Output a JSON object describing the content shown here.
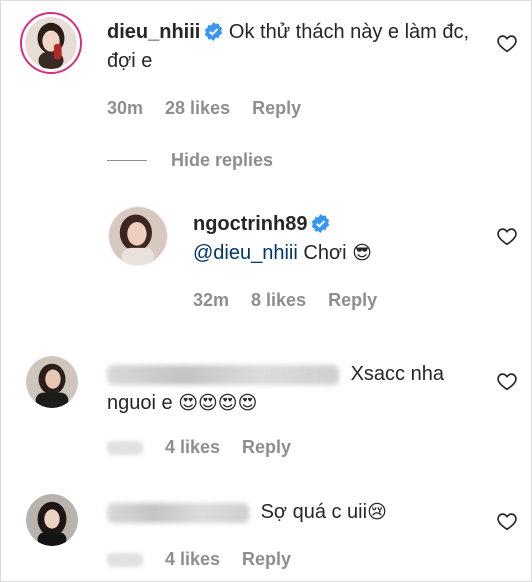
{
  "comments": [
    {
      "username": "dieu_nhiii",
      "verified": true,
      "text": "Ok thử thách này e làm đc, đợi e",
      "time": "30m",
      "likes": "28 likes",
      "reply": "Reply"
    },
    {
      "username": "ngoctrinh89",
      "verified": true,
      "mention": "@dieu_nhiii",
      "text": "Chơi",
      "emoji": "😎",
      "time": "32m",
      "likes": "8 likes",
      "reply": "Reply"
    },
    {
      "text_line1": "Xsacc nha",
      "text_line2": "nguoi e",
      "emoji": "😍😍😍😍",
      "likes": "4 likes",
      "reply": "Reply"
    },
    {
      "text": "Sợ quá c uii",
      "emoji": "😢",
      "likes": "4 likes",
      "reply": "Reply"
    }
  ],
  "hide_replies_label": "Hide replies",
  "icons": {
    "verified": "verified-badge-icon",
    "like": "heart-outline-icon"
  },
  "colors": {
    "verified": "#3897f0",
    "meta": "#8e8e8e",
    "mention": "#00376b",
    "story_ring": "#d92e7f"
  }
}
